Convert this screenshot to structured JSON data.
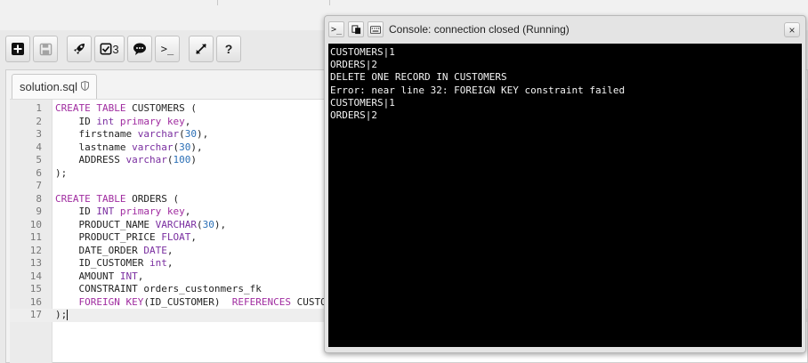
{
  "toolbar": {
    "test_count": "3",
    "prompt_label": ">_",
    "help_label": "?"
  },
  "file_tab": {
    "name": "solution.sql"
  },
  "code_lines": [
    "CREATE TABLE CUSTOMERS (",
    "    ID int primary key,",
    "    firstname varchar(30),",
    "    lastname varchar(30),",
    "    ADDRESS varchar(100)",
    ");",
    "",
    "CREATE TABLE ORDERS (",
    "    ID INT primary key,",
    "    PRODUCT_NAME VARCHAR(30),",
    "    PRODUCT_PRICE FLOAT,",
    "    DATE_ORDER DATE,",
    "    ID_CUSTOMER int,",
    "    AMOUNT INT,",
    "    CONSTRAINT orders_custonmers_fk",
    "    FOREIGN KEY(ID_CUSTOMER)  REFERENCES CUSTO",
    ");"
  ],
  "console": {
    "title": "Console: connection closed (Running)",
    "prompt_icon": ">_",
    "close_label": "×",
    "output": [
      "CUSTOMERS|1",
      "ORDERS|2",
      "DELETE ONE RECORD IN CUSTOMERS",
      "Error: near line 32: FOREIGN KEY constraint failed",
      "CUSTOMERS|1",
      "ORDERS|2"
    ]
  }
}
